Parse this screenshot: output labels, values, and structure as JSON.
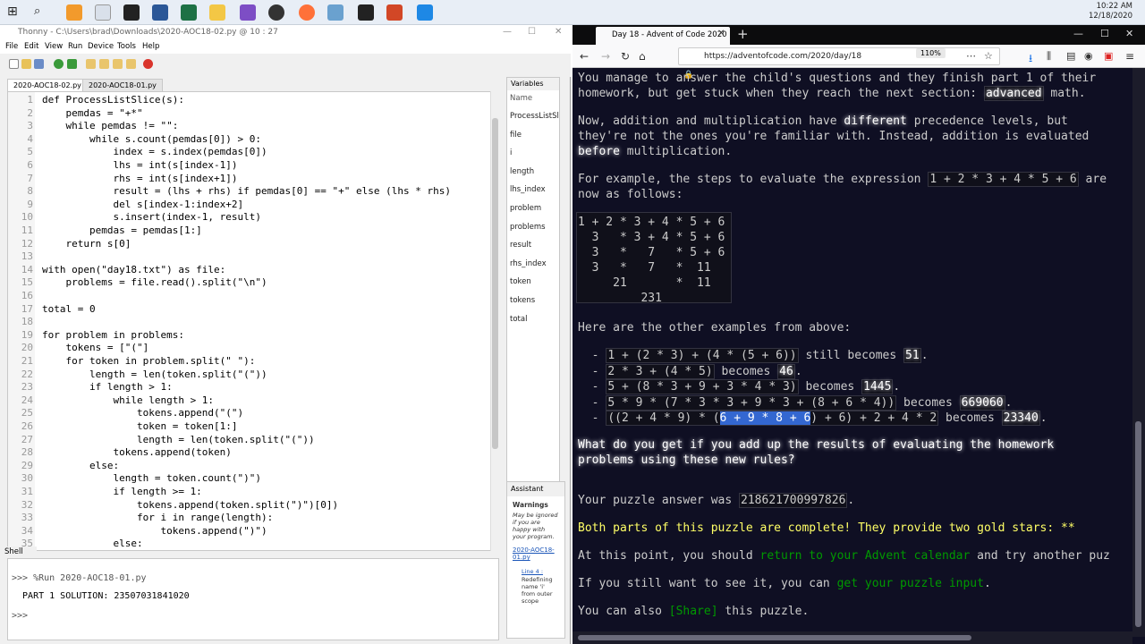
{
  "tray": {
    "time": "10:22 AM",
    "date": "12/18/2020"
  },
  "thonny": {
    "title": "Thonny  -  C:\\Users\\brad\\Downloads\\2020-AOC18-02.py  @  10 : 27",
    "menu": [
      "File",
      "Edit",
      "View",
      "Run",
      "Device",
      "Tools",
      "Help"
    ],
    "tabs": [
      "2020-AOC18-02.py",
      "2020-AOC18-01.py"
    ],
    "line_numbers": [
      "1",
      "2",
      "3",
      "4",
      "5",
      "6",
      "7",
      "8",
      "9",
      "10",
      "11",
      "12",
      "13",
      "14",
      "15",
      "16",
      "17",
      "18",
      "19",
      "20",
      "21",
      "22",
      "23",
      "24",
      "25",
      "26",
      "27",
      "28",
      "29",
      "30",
      "31",
      "32",
      "33",
      "34",
      "35"
    ],
    "code": [
      "def ProcessListSlice(s):",
      "    pemdas = \"+*\"",
      "    while pemdas != \"\":",
      "        while s.count(pemdas[0]) > 0:",
      "            index = s.index(pemdas[0])",
      "            lhs = int(s[index-1])",
      "            rhs = int(s[index+1])",
      "            result = (lhs + rhs) if pemdas[0] == \"+\" else (lhs * rhs)",
      "            del s[index-1:index+2]",
      "            s.insert(index-1, result)",
      "        pemdas = pemdas[1:]",
      "    return s[0]",
      "",
      "with open(\"day18.txt\") as file:",
      "    problems = file.read().split(\"\\n\")",
      "",
      "total = 0",
      "",
      "for problem in problems:",
      "    tokens = [\"(\"]",
      "    for token in problem.split(\" \"):",
      "        length = len(token.split(\"(\"))",
      "        if length > 1:",
      "            while length > 1:",
      "                tokens.append(\"(\")",
      "                token = token[1:]",
      "                length = len(token.split(\"(\"))",
      "            tokens.append(token)",
      "        else:",
      "            length = token.count(\")\")",
      "            if length >= 1:",
      "                tokens.append(token.split(\")\")[0])",
      "                for i in range(length):",
      "                    tokens.append(\")\")",
      "            else:"
    ],
    "variables": {
      "header": "Variables",
      "col": "Name",
      "items": [
        "ProcessListSlice",
        "file",
        "i",
        "length",
        "lhs_index",
        "problem",
        "problems",
        "result",
        "rhs_index",
        "token",
        "tokens",
        "total"
      ]
    },
    "assistant": {
      "header": "Assistant",
      "warnings": "Warnings",
      "note": "May be ignored if you are happy with your program.",
      "link1": "2020-AOC18-01.py",
      "link2": "Line 4 :",
      "detail": "Redefining name 'i' from outer scope"
    },
    "shell": {
      "header": "Shell",
      "lines": [
        ">>> %Run 2020-AOC18-01.py",
        "  PART 1 SOLUTION: 23507031841020",
        ">>> "
      ]
    }
  },
  "firefox": {
    "tab_title": "Day 18 - Advent of Code 2020",
    "url": "https://adventofcode.com/2020/day/18",
    "zoom": "110%",
    "p1a": "You manage to answer the child's questions and they finish part 1 of their",
    "p1b": "homework, but get stuck when they reach the next section: ",
    "p1c": "advanced",
    "p1d": " math.",
    "p2a": "Now, addition and multiplication have ",
    "p2b": "different",
    "p2c": " precedence levels, but",
    "p2d": "they're not the ones you're familiar with. Instead, addition is evaluated",
    "p2e": "before",
    "p2f": " multiplication.",
    "p3a": "For example, the steps to evaluate the expression ",
    "p3b": "1 + 2 * 3 + 4 * 5 + 6",
    "p3c": " are",
    "p3d": "now as follows:",
    "steps": [
      "1 + 2 * 3 + 4 * 5 + 6",
      "  3   * 3 + 4 * 5 + 6",
      "  3   *   7   * 5 + 6",
      "  3   *   7   *  11",
      "     21       *  11",
      "         231"
    ],
    "p4": "Here are the other examples from above:",
    "examples": [
      {
        "expr": "1 + (2 * 3) + (4 * (5 + 6))",
        "mid": " still becomes ",
        "val": "51"
      },
      {
        "expr": "2 * 3 + (4 * 5)",
        "mid": " becomes ",
        "val": "46"
      },
      {
        "expr": "5 + (8 * 3 + 9 + 3 * 4 * 3)",
        "mid": " becomes ",
        "val": "1445"
      },
      {
        "expr": "5 * 9 * (7 * 3 * 3 + 9 * 3 + (8 + 6 * 4))",
        "mid": " becomes ",
        "val": "669060"
      }
    ],
    "ex5a": "((2 + 4 * 9) * (",
    "ex5sel": "6 + 9 * 8 + 6",
    "ex5b": ") + 6) + 2 + 4 * 2",
    "ex5mid": " becomes ",
    "ex5val": "23340",
    "q1": "What do you get if you add up the results of evaluating the homework",
    "q2": "problems using these new rules?",
    "ans_label": "Your puzzle answer was ",
    "ans": "218621700997826",
    "done": "Both parts of this puzzle are complete! They provide two gold stars: **",
    "cal_a": "At this point, you should ",
    "cal_link": "return to your Advent calendar",
    "cal_b": " and try another puz",
    "inp_a": "If you still want to see it, you can ",
    "inp_link": "get your puzzle input",
    "inp_b": ".",
    "share_a": "You can also ",
    "share_link": "[Share]",
    "share_b": " this puzzle."
  }
}
